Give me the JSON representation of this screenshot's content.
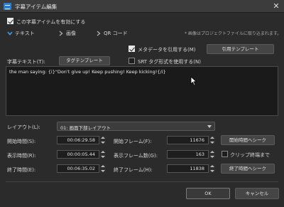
{
  "window": {
    "title": "字幕アイテム編集",
    "close_glyph": "✕"
  },
  "enable_checkbox": {
    "label": "この字幕アイテムを有効にする",
    "checked": true
  },
  "tabs": [
    {
      "label": "テキスト",
      "expanded": true
    },
    {
      "label": "画像",
      "expanded": false
    },
    {
      "label": "QR コード",
      "expanded": false
    }
  ],
  "hint": "* 画像はプロジェクトファイルに取り込まれます。",
  "metadata_checkbox": {
    "label": "メタデータを引用する(M)",
    "checked": true
  },
  "quote_template_button": "引用テンプレート",
  "subtitle_text_label": "字幕テキスト(T):",
  "tag_template_button": "タグテンプレート",
  "srt_checkbox": {
    "label": "SRT タグ形式を使用する(N)",
    "checked": false
  },
  "subtitle_text": "the man saying: {i}\"Don't give up! Keep pushing! Keep kicking!{/i}",
  "layout": {
    "label": "レイアウト(L):",
    "value": "01: 画面下部レイアウト"
  },
  "rows": {
    "start_time": {
      "label": "開始時間(S):",
      "value": "00:06:29.58"
    },
    "display_time": {
      "label": "表示時間(R):",
      "value": "00:00:05.44"
    },
    "end_time": {
      "label": "終了時間(E):",
      "value": "00:06:35.02"
    },
    "start_frame": {
      "label": "開始フレーム(F):",
      "value": "11676"
    },
    "display_frames": {
      "label": "表示フレーム数(G):",
      "value": "163"
    },
    "end_frame": {
      "label": "終了フレーム(H):",
      "value": "11838"
    }
  },
  "seek_start_button": "開始時間へシーク",
  "clip_end_checkbox": {
    "label": "クリップ終端まで",
    "checked": false
  },
  "seek_end_button": "終了時間へシーク",
  "ok_button": "OK",
  "cancel_button": "キャンセル"
}
